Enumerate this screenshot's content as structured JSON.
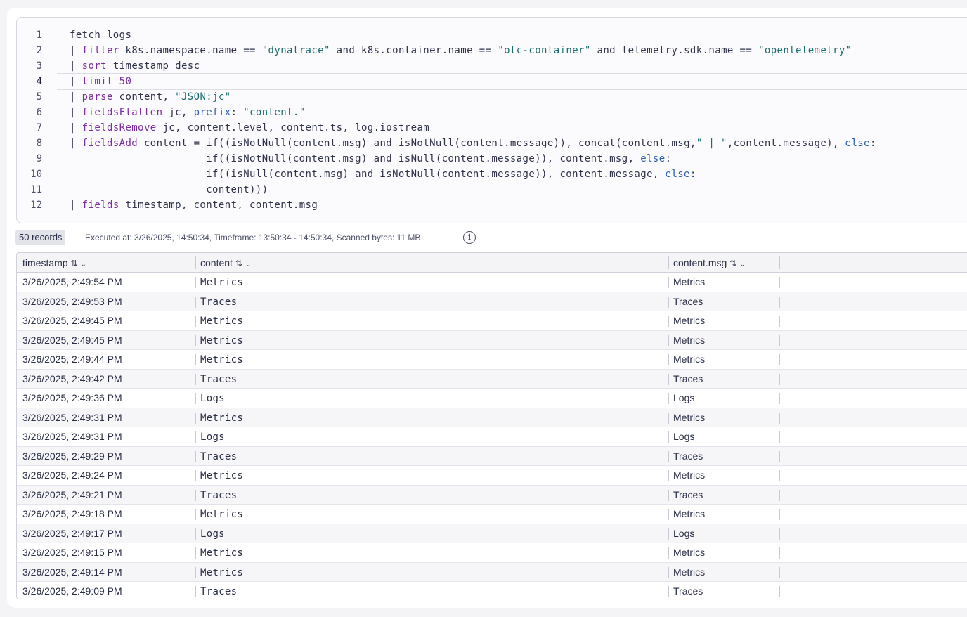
{
  "editor": {
    "line_numbers": [
      "1",
      "2",
      "3",
      "4",
      "5",
      "6",
      "7",
      "8",
      "9",
      "10",
      "11",
      "12"
    ],
    "active_line": 4,
    "lines": [
      [
        {
          "t": "fetch logs",
          "c": ""
        }
      ],
      [
        {
          "t": "| ",
          "c": ""
        },
        {
          "t": "filter",
          "c": "k"
        },
        {
          "t": " k8s.namespace.name == ",
          "c": ""
        },
        {
          "t": "\"dynatrace\"",
          "c": "s"
        },
        {
          "t": " and k8s.container.name == ",
          "c": ""
        },
        {
          "t": "\"otc-container\"",
          "c": "s"
        },
        {
          "t": " and telemetry.sdk.name == ",
          "c": ""
        },
        {
          "t": "\"opentelemetry\"",
          "c": "s"
        }
      ],
      [
        {
          "t": "| ",
          "c": ""
        },
        {
          "t": "sort",
          "c": "k"
        },
        {
          "t": " timestamp desc",
          "c": ""
        }
      ],
      [
        {
          "t": "| ",
          "c": ""
        },
        {
          "t": "limit",
          "c": "k"
        },
        {
          "t": " ",
          "c": ""
        },
        {
          "t": "50",
          "c": "n"
        }
      ],
      [
        {
          "t": "| ",
          "c": ""
        },
        {
          "t": "parse",
          "c": "k"
        },
        {
          "t": " content, ",
          "c": ""
        },
        {
          "t": "\"JSON:jc\"",
          "c": "s"
        }
      ],
      [
        {
          "t": "| ",
          "c": ""
        },
        {
          "t": "fieldsFlatten",
          "c": "k"
        },
        {
          "t": " jc, ",
          "c": ""
        },
        {
          "t": "prefix",
          "c": "p"
        },
        {
          "t": ": ",
          "c": ""
        },
        {
          "t": "\"content.\"",
          "c": "s"
        }
      ],
      [
        {
          "t": "| ",
          "c": ""
        },
        {
          "t": "fieldsRemove",
          "c": "k"
        },
        {
          "t": " jc, content.level, content.ts, log.iostream",
          "c": ""
        }
      ],
      [
        {
          "t": "| ",
          "c": ""
        },
        {
          "t": "fieldsAdd",
          "c": "k"
        },
        {
          "t": " content = if((isNotNull(content.msg) and isNotNull(content.message)), concat(content.msg,",
          "c": ""
        },
        {
          "t": "\" | \"",
          "c": "s"
        },
        {
          "t": ",content.message), ",
          "c": ""
        },
        {
          "t": "else",
          "c": "p"
        },
        {
          "t": ":",
          "c": ""
        }
      ],
      [
        {
          "t": "                      if((isNotNull(content.msg) and isNull(content.message)), content.msg, ",
          "c": ""
        },
        {
          "t": "else",
          "c": "p"
        },
        {
          "t": ":",
          "c": ""
        }
      ],
      [
        {
          "t": "                      if((isNull(content.msg) and isNotNull(content.message)), content.message, ",
          "c": ""
        },
        {
          "t": "else",
          "c": "p"
        },
        {
          "t": ":",
          "c": ""
        }
      ],
      [
        {
          "t": "                      content)))",
          "c": ""
        }
      ],
      [
        {
          "t": "| ",
          "c": ""
        },
        {
          "t": "fields",
          "c": "k"
        },
        {
          "t": " timestamp, content, content.msg",
          "c": ""
        }
      ]
    ]
  },
  "status": {
    "records": "50 records",
    "executed": "Executed at: 3/26/2025, 14:50:34, Timeframe: 13:50:34 - 14:50:34, Scanned bytes: 11 MB",
    "info_icon": "info-icon"
  },
  "table": {
    "columns": [
      {
        "label": "timestamp",
        "sort_icon": "⇅",
        "menu_icon": "⌄"
      },
      {
        "label": "content",
        "sort_icon": "⇅",
        "menu_icon": "⌄"
      },
      {
        "label": "content.msg",
        "sort_icon": "⇅",
        "menu_icon": "⌄"
      }
    ],
    "rows": [
      [
        "3/26/2025, 2:49:54 PM",
        "Metrics",
        "Metrics"
      ],
      [
        "3/26/2025, 2:49:53 PM",
        "Traces",
        "Traces"
      ],
      [
        "3/26/2025, 2:49:45 PM",
        "Metrics",
        "Metrics"
      ],
      [
        "3/26/2025, 2:49:45 PM",
        "Metrics",
        "Metrics"
      ],
      [
        "3/26/2025, 2:49:44 PM",
        "Metrics",
        "Metrics"
      ],
      [
        "3/26/2025, 2:49:42 PM",
        "Traces",
        "Traces"
      ],
      [
        "3/26/2025, 2:49:36 PM",
        "Logs",
        "Logs"
      ],
      [
        "3/26/2025, 2:49:31 PM",
        "Metrics",
        "Metrics"
      ],
      [
        "3/26/2025, 2:49:31 PM",
        "Logs",
        "Logs"
      ],
      [
        "3/26/2025, 2:49:29 PM",
        "Traces",
        "Traces"
      ],
      [
        "3/26/2025, 2:49:24 PM",
        "Metrics",
        "Metrics"
      ],
      [
        "3/26/2025, 2:49:21 PM",
        "Traces",
        "Traces"
      ],
      [
        "3/26/2025, 2:49:18 PM",
        "Metrics",
        "Metrics"
      ],
      [
        "3/26/2025, 2:49:17 PM",
        "Logs",
        "Logs"
      ],
      [
        "3/26/2025, 2:49:15 PM",
        "Metrics",
        "Metrics"
      ],
      [
        "3/26/2025, 2:49:14 PM",
        "Metrics",
        "Metrics"
      ],
      [
        "3/26/2025, 2:49:09 PM",
        "Traces",
        "Traces"
      ]
    ]
  },
  "colors": {
    "keyword": "#7a2e9b",
    "string": "#1d6d6f",
    "param": "#2b5fb0"
  }
}
